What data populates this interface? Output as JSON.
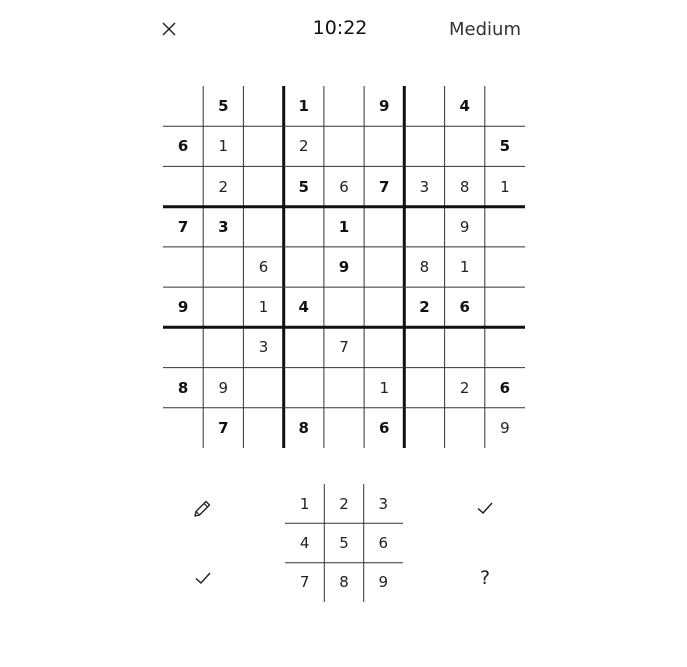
{
  "header": {
    "close_icon": "close-icon",
    "timer": "10:22",
    "difficulty": "Medium"
  },
  "board": {
    "cells": [
      [
        "",
        "5",
        "",
        "1",
        "",
        "9",
        "",
        "4",
        ""
      ],
      [
        "6",
        "1",
        "",
        "2",
        "",
        "",
        "",
        "",
        "5"
      ],
      [
        "",
        "2",
        "",
        "5",
        "6",
        "7",
        "3",
        "8",
        "1"
      ],
      [
        "7",
        "3",
        "",
        "",
        "1",
        "",
        "",
        "9",
        ""
      ],
      [
        "",
        "",
        "6",
        "",
        "9",
        "",
        "8",
        "1",
        ""
      ],
      [
        "9",
        "",
        "1",
        "4",
        "",
        "",
        "2",
        "6",
        ""
      ],
      [
        "",
        "",
        "3",
        "",
        "7",
        "",
        "",
        "",
        ""
      ],
      [
        "8",
        "9",
        "",
        "",
        "",
        "1",
        "",
        "2",
        "6"
      ],
      [
        "",
        "7",
        "",
        "8",
        "",
        "6",
        "",
        "",
        "9"
      ]
    ],
    "given": [
      [
        0,
        1,
        0,
        1,
        0,
        1,
        0,
        1,
        0
      ],
      [
        1,
        0,
        0,
        0,
        0,
        0,
        0,
        0,
        1
      ],
      [
        0,
        0,
        0,
        1,
        0,
        1,
        0,
        0,
        0
      ],
      [
        1,
        1,
        0,
        0,
        1,
        0,
        0,
        0,
        0
      ],
      [
        0,
        0,
        0,
        0,
        1,
        0,
        0,
        0,
        0
      ],
      [
        1,
        0,
        0,
        1,
        0,
        0,
        1,
        1,
        0
      ],
      [
        0,
        0,
        0,
        0,
        0,
        0,
        0,
        0,
        0
      ],
      [
        1,
        0,
        0,
        0,
        0,
        0,
        0,
        0,
        1
      ],
      [
        0,
        1,
        0,
        1,
        0,
        1,
        0,
        0,
        0
      ]
    ]
  },
  "tools": {
    "pencil_icon": "pencil-icon",
    "check_icon": "check-icon",
    "question_label": "?"
  },
  "numpad": {
    "keys": [
      "1",
      "2",
      "3",
      "4",
      "5",
      "6",
      "7",
      "8",
      "9"
    ]
  }
}
